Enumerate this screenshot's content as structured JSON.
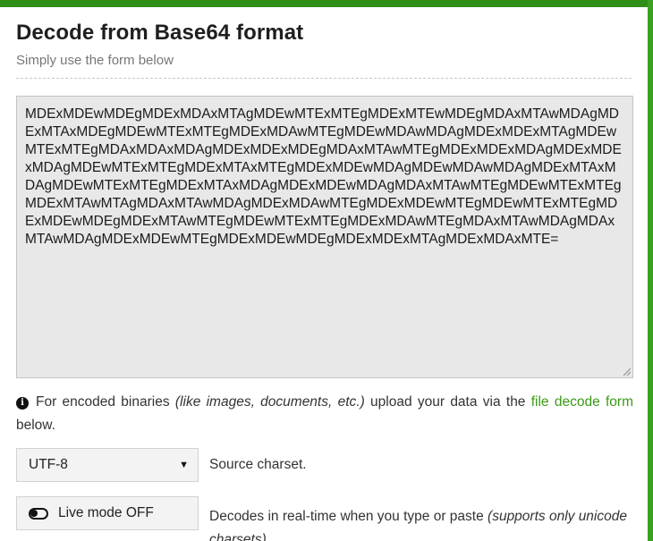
{
  "header": {
    "title": "Decode from Base64 format",
    "subtitle": "Simply use the form below"
  },
  "input": {
    "value": "MDExMDEwMDEgMDExMDAxMTAgMDEwMTExMTEgMDExMTEwMDEgMDAxMTAwMDAgMDExMTAxMDEgMDEwMTExMTEgMDExMDAwMTEgMDEwMDAwMDAgMDExMDExMTAgMDEwMTExMTEgMDAxMDAxMDAgMDExMDExMDEgMDAxMTAwMTEgMDExMDExMDAgMDExMDExMDAgMDEwMTExMTEgMDExMTAxMTEgMDExMDEwMDAgMDEwMDAwMDAgMDExMTAxMDAgMDEwMTExMTEgMDExMTAxMDAgMDExMDEwMDAgMDAxMTAwMTEgMDEwMTExMTEgMDExMTAwMTAgMDAxMTAwMDAgMDExMDAwMTEgMDExMDEwMTEgMDEwMTExMTEgMDExMDEwMDEgMDExMTAwMTEgMDEwMTExMTEgMDExMDAwMTEgMDAxMTAwMDAgMDAxMTAwMDAgMDExMDEwMTEgMDExMDEwMDEgMDExMDExMTAgMDExMDAxMTE="
  },
  "info": {
    "prefix": "For encoded binaries",
    "italic": "(like images, documents, etc.)",
    "middle": "upload your data via the",
    "link": "file decode form",
    "suffix": "below."
  },
  "charset": {
    "selected": "UTF-8",
    "label": "Source charset."
  },
  "live_mode": {
    "button_label": "Live mode OFF",
    "description": "Decodes in real-time when you type or paste",
    "italic": "(supports only unicode charsets)."
  },
  "colors": {
    "accent": "#3aa11f",
    "link": "#3a9a16"
  },
  "icons": {
    "info": "info-circle-icon",
    "toggle": "toggle-off-icon",
    "caret": "caret-down-icon"
  }
}
